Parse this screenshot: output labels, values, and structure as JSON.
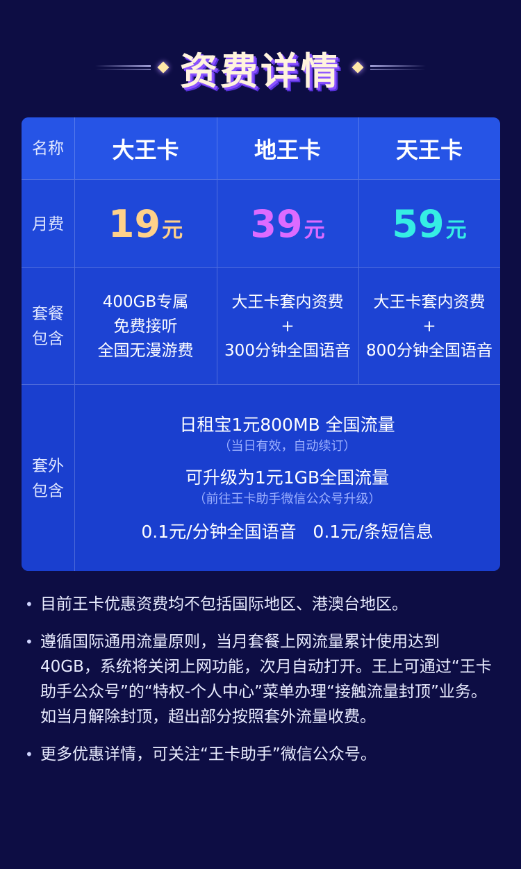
{
  "title": "资费详情",
  "table": {
    "row_labels": {
      "name": "名称",
      "monthly": "月费",
      "package": [
        "套餐",
        "包含"
      ],
      "extra": [
        "套外",
        "包含"
      ]
    },
    "cards": [
      {
        "name": "大王卡",
        "price": "19",
        "unit": "元",
        "price_color": "#ffd18a",
        "package": [
          "400GB专属",
          "免费接听",
          "全国无漫游费"
        ]
      },
      {
        "name": "地王卡",
        "price": "39",
        "unit": "元",
        "price_color": "#dd6bff",
        "package": [
          "大王卡套内资费",
          "+",
          "300分钟全国语音"
        ]
      },
      {
        "name": "天王卡",
        "price": "59",
        "unit": "元",
        "price_color": "#35eee4",
        "package": [
          "大王卡套内资费",
          "+",
          "800分钟全国语音"
        ]
      }
    ],
    "extra": {
      "line1": "日租宝1元800MB 全国流量",
      "line1_sub": "（当日有效，自动续订）",
      "line2": "可升级为1元1GB全国流量",
      "line2_sub": "（前往王卡助手微信公众号升级）",
      "line3": "0.1元/分钟全国语音   0.1元/条短信息"
    }
  },
  "notes": [
    "目前王卡优惠资费均不包括国际地区、港澳台地区。",
    "遵循国际通用流量原则，当月套餐上网流量累计使用达到40GB，系统将关闭上网功能，次月自动打开。王上可通过“王卡助手公众号”的“特权-个人中心”菜单办理“接触流量封顶”业务。如当月解除封顶，超出部分按照套外流量收费。",
    "更多优惠详情，可关注“王卡助手”微信公众号。"
  ],
  "colors": {
    "background": "#0d0d44",
    "table_blue": "#1c45d8",
    "title_shadow": "#8b52ff"
  }
}
